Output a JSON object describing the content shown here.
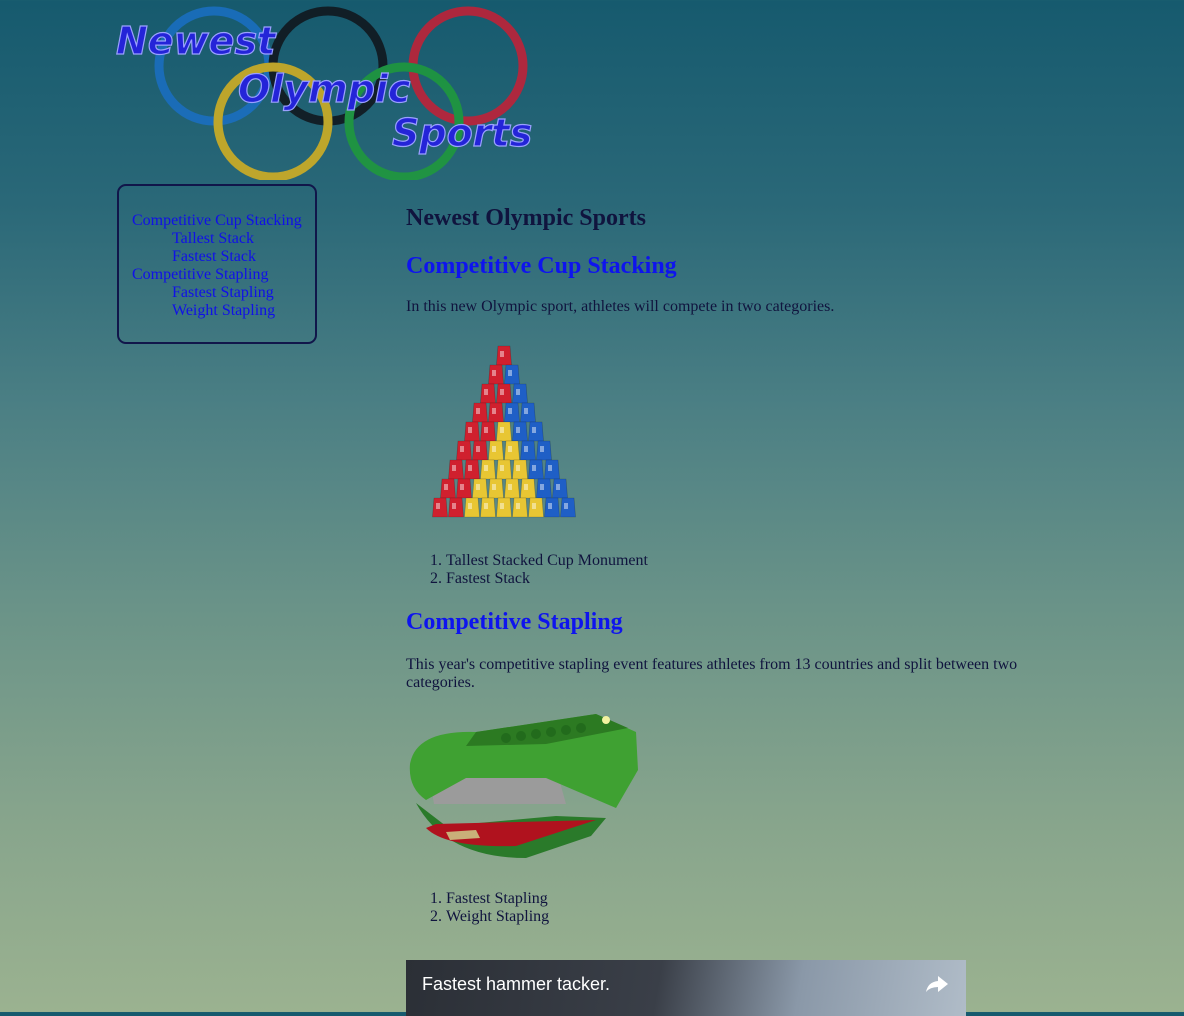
{
  "header": {
    "logo_lines": [
      "Newest",
      "Olympic",
      "Sports"
    ]
  },
  "nav": {
    "items": [
      {
        "label": "Competitive Cup Stacking",
        "level": 0
      },
      {
        "label": "Tallest Stack",
        "level": 1
      },
      {
        "label": "Fastest Stack",
        "level": 1
      },
      {
        "label": "Competitive Stapling",
        "level": 0
      },
      {
        "label": "Fastest Stapling",
        "level": 1
      },
      {
        "label": "Weight Stapling",
        "level": 1
      }
    ]
  },
  "main": {
    "title": "Newest Olympic Sports",
    "cup": {
      "heading": "Competitive Cup Stacking",
      "intro": "In this new Olympic sport, athletes will compete in two categories.",
      "list": [
        "Tallest Stacked Cup Monument",
        "Fastest Stack"
      ]
    },
    "staple": {
      "heading": "Competitive Stapling",
      "intro": "This year's competitive stapling event features athletes from 13 countries and split between two categories.",
      "list": [
        "Fastest Stapling",
        "Weight Stapling"
      ]
    },
    "video": {
      "title": "Fastest hammer tacker."
    }
  },
  "colors": {
    "link": "#1010e8",
    "heading_link": "#0e14ee",
    "text": "#10143e",
    "ring_blue": "#1a6fc4",
    "ring_black": "#10141a",
    "ring_red": "#c81f35",
    "ring_yellow": "#d9b21f",
    "ring_green": "#1f9c3a"
  }
}
